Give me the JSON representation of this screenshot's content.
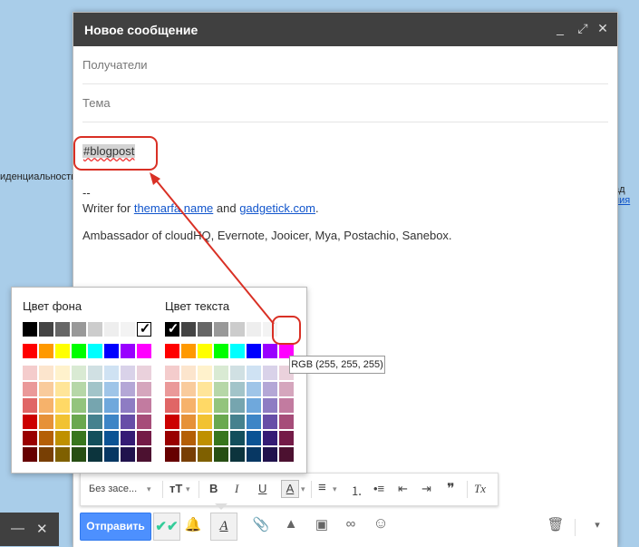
{
  "background": {
    "left_text": "иденциальность",
    "right_text_1": "ад",
    "right_text_2": "ния"
  },
  "minimized_bar": {
    "minimize": "—",
    "close": "✕"
  },
  "compose": {
    "title": "Новое сообщение",
    "controls": {
      "minimize": "_",
      "expand": "⤢",
      "close": "✕"
    },
    "recipients_placeholder": "Получатели",
    "subject_placeholder": "Тема",
    "body": {
      "hashtag": "#blogpost",
      "sig_dash": "--",
      "writer_prefix": "Writer for ",
      "link1": "themarfa.name",
      "and": " and ",
      "link2": "gadgetick.com",
      "period": ".",
      "ambassador": "Ambassador of cloudHQ, Evernote, Jooicer, Mya, Postachio, Sanebox."
    }
  },
  "palette": {
    "bg_title": "Цвет фона",
    "text_title": "Цвет текста",
    "grays": [
      "#000000",
      "#444444",
      "#666666",
      "#999999",
      "#cccccc",
      "#eeeeee",
      "#f3f3f3",
      "#ffffff"
    ],
    "brights": [
      "#ff0000",
      "#ff9900",
      "#ffff00",
      "#00ff00",
      "#00ffff",
      "#0000ff",
      "#9900ff",
      "#ff00ff"
    ],
    "pastels": [
      [
        "#f4cccc",
        "#fce5cd",
        "#fff2cc",
        "#d9ead3",
        "#d0e0e3",
        "#cfe2f3",
        "#d9d2e9",
        "#ead1dc"
      ],
      [
        "#ea9999",
        "#f9cb9c",
        "#ffe599",
        "#b6d7a8",
        "#a2c4c9",
        "#9fc5e8",
        "#b4a7d6",
        "#d5a6bd"
      ],
      [
        "#e06666",
        "#f6b26b",
        "#ffd966",
        "#93c47d",
        "#76a5af",
        "#6fa8dc",
        "#8e7cc3",
        "#c27ba0"
      ],
      [
        "#cc0000",
        "#e69138",
        "#f1c232",
        "#6aa84f",
        "#45818e",
        "#3d85c6",
        "#674ea7",
        "#a64d79"
      ],
      [
        "#990000",
        "#b45f06",
        "#bf9000",
        "#38761d",
        "#134f5c",
        "#0b5394",
        "#351c75",
        "#741b47"
      ],
      [
        "#660000",
        "#783f04",
        "#7f6000",
        "#274e13",
        "#0c343d",
        "#073763",
        "#20124d",
        "#4c1130"
      ]
    ],
    "bg_selected_mark": "✓",
    "text_selected_mark": "✓",
    "tooltip": "RGB (255, 255, 255)",
    "highlight_color": "#d93025"
  },
  "format_bar": {
    "font": "Без засе...",
    "size_icon": "тТ",
    "bold": "B",
    "italic": "I",
    "underline": "U",
    "text_color": "A",
    "align": "≡",
    "numbered": "⒈",
    "bulleted": "•≡",
    "outdent": "⇤",
    "indent": "⇥",
    "quote": "❞",
    "clear": "Tx"
  },
  "bottom_bar": {
    "send": "Отправить",
    "check": "✔✔",
    "bell": "🔔",
    "format": "A",
    "attach": "📎",
    "drive": "▲",
    "photo": "▣",
    "link": "∞",
    "emoji": "☺",
    "trash": "🗑",
    "more": "▾"
  }
}
